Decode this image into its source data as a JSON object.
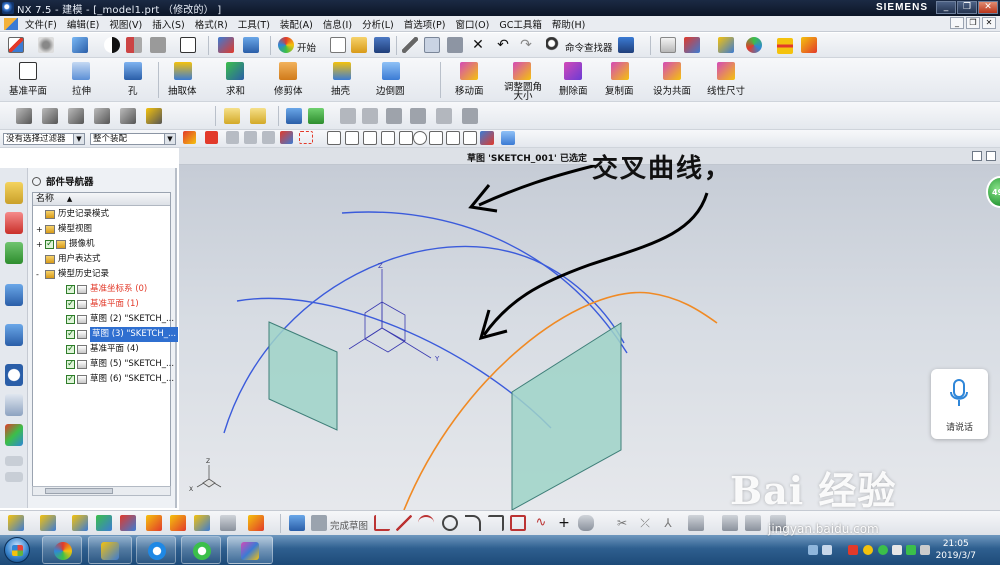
{
  "window": {
    "title": "NX 7.5 - 建模 - [_model1.prt （修改的） ]",
    "brand": "SIEMENS",
    "controls": [
      "_",
      "❐",
      "✕"
    ]
  },
  "menubar": {
    "items": [
      "文件(F)",
      "编辑(E)",
      "视图(V)",
      "插入(S)",
      "格式(R)",
      "工具(T)",
      "装配(A)",
      "信息(I)",
      "分析(L)",
      "首选项(P)",
      "窗口(O)",
      "GC工具箱",
      "帮助(H)"
    ],
    "mdi_controls": [
      "_",
      "❐",
      "✕"
    ]
  },
  "toolbar_standard": {
    "start_label": "开始",
    "command_finder_label": "命令查找器"
  },
  "toolbar_features": {
    "items": [
      "基准平面",
      "拉伸",
      "孔",
      "抽取体",
      "求和",
      "修剪体",
      "抽壳",
      "边倒圆",
      "移动面",
      "调整圆角大小",
      "删除面",
      "复制面",
      "设为共面",
      "线性尺寸"
    ]
  },
  "selection_bar": {
    "filter_value": "没有选择过滤器",
    "scope_value": "整个装配"
  },
  "part_navigator": {
    "title": "部件导航器",
    "column_name": "名称",
    "rows": [
      {
        "text": "历史记录模式",
        "indent": 1,
        "expander": "",
        "check": false,
        "style": "normal"
      },
      {
        "text": "模型视图",
        "indent": 1,
        "expander": "+",
        "check": false,
        "style": "normal"
      },
      {
        "text": "摄像机",
        "indent": 1,
        "expander": "+",
        "check": true,
        "style": "normal"
      },
      {
        "text": "用户表达式",
        "indent": 1,
        "expander": "",
        "check": false,
        "style": "normal"
      },
      {
        "text": "模型历史记录",
        "indent": 1,
        "expander": "-",
        "check": false,
        "style": "normal"
      },
      {
        "text": "基准坐标系 (0)",
        "indent": 2,
        "expander": "",
        "check": true,
        "style": "red"
      },
      {
        "text": "基准平面 (1)",
        "indent": 2,
        "expander": "",
        "check": true,
        "style": "red"
      },
      {
        "text": "草图 (2) \"SKETCH_...",
        "indent": 2,
        "expander": "",
        "check": true,
        "style": "normal"
      },
      {
        "text": "草图 (3) \"SKETCH_...",
        "indent": 2,
        "expander": "",
        "check": true,
        "style": "selected"
      },
      {
        "text": "基准平面 (4)",
        "indent": 2,
        "expander": "",
        "check": true,
        "style": "normal"
      },
      {
        "text": "草图 (5) \"SKETCH_...",
        "indent": 2,
        "expander": "",
        "check": true,
        "style": "normal"
      },
      {
        "text": "草图 (6) \"SKETCH_...",
        "indent": 2,
        "expander": "",
        "check": true,
        "style": "normal"
      }
    ]
  },
  "viewport": {
    "status_text": "草图 'SKETCH_001' 已选定",
    "axis_labels": {
      "z": "Z",
      "y": "Y",
      "x": "X"
    }
  },
  "annotation": {
    "text": "交叉曲线，"
  },
  "sketch_bar": {
    "finish_label": "完成草图"
  },
  "overlay": {
    "voice_label": "请说话",
    "badge_text": "49",
    "watermark_text": "Bai 经验",
    "watermark_url": "jingyan.baidu.com"
  },
  "taskbar": {
    "time": "21:05",
    "date": "2019/3/7"
  },
  "colors": {
    "curve_blue": "#3b5bdb",
    "curve_orange": "#f08a24",
    "plane_fill": "#9fd4c8",
    "selection_blue": "#2f6fd0",
    "feature_red": "#e23a2a"
  }
}
